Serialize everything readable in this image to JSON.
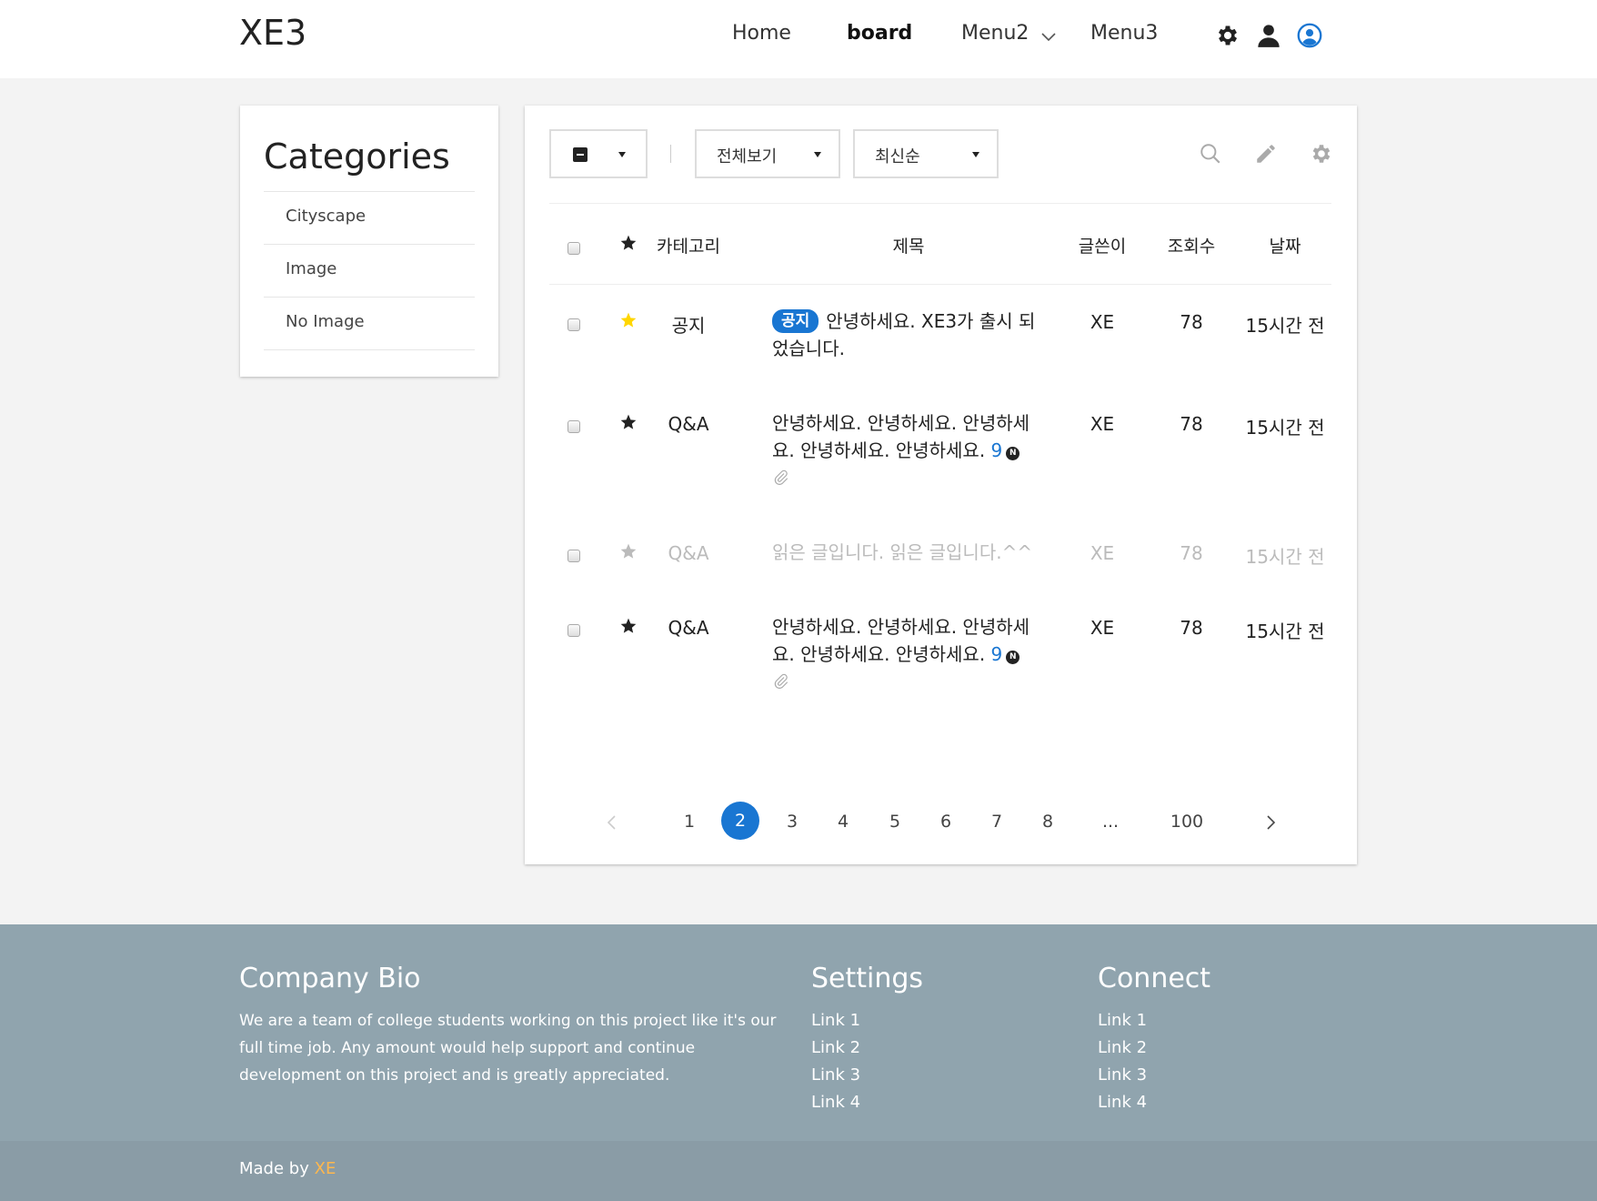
{
  "header": {
    "logo": "XE3",
    "nav": [
      {
        "label": "Home"
      },
      {
        "label": "board"
      },
      {
        "label": "Menu2"
      },
      {
        "label": "Menu3"
      }
    ],
    "icons": [
      "gear-icon",
      "user-icon",
      "account-circle-icon"
    ]
  },
  "sidebar": {
    "title": "Categories",
    "items": [
      {
        "label": "Cityscape"
      },
      {
        "label": "Image"
      },
      {
        "label": "No Image"
      }
    ]
  },
  "toolbar": {
    "view_select": "전체보기",
    "sort_select": "최신순",
    "icons": [
      "search-icon",
      "pencil-icon",
      "gear-icon"
    ]
  },
  "table": {
    "headers": {
      "category": "카테고리",
      "title": "제목",
      "author": "글쓴이",
      "views": "조회수",
      "date": "날짜"
    },
    "rows": [
      {
        "category": "공지",
        "badge": "공지",
        "title": "안녕하세요. XE3가 출시 되었습니다.",
        "author": "XE",
        "views": "78",
        "date": "15시간 전",
        "starred": true,
        "read": false
      },
      {
        "category": "Q&A",
        "title": "안녕하세요. 안녕하세요. 안녕하세요. 안녕하세요. 안녕하세요.",
        "comment_count": "9",
        "new_mark": "N",
        "attachment": true,
        "author": "XE",
        "views": "78",
        "date": "15시간 전",
        "starred": false,
        "read": false
      },
      {
        "category": "Q&A",
        "title": "읽은 글입니다. 읽은 글입니다.^^",
        "author": "XE",
        "views": "78",
        "date": "15시간 전",
        "starred": false,
        "read": true
      },
      {
        "category": "Q&A",
        "title": "안녕하세요. 안녕하세요. 안녕하세요. 안녕하세요. 안녕하세요.",
        "comment_count": "9",
        "new_mark": "N",
        "attachment": true,
        "author": "XE",
        "views": "78",
        "date": "15시간 전",
        "starred": false,
        "read": false
      }
    ]
  },
  "pagination": {
    "pages": [
      "1",
      "2",
      "3",
      "4",
      "5",
      "6",
      "7",
      "8",
      "...",
      "100"
    ],
    "current": "2"
  },
  "footer": {
    "bio": {
      "title": "Company Bio",
      "text": "We are a team of college students working on this project like it's our full time job. Any amount would help support and continue development on this project and is greatly appreciated."
    },
    "settings": {
      "title": "Settings",
      "links": [
        "Link 1",
        "Link 2",
        "Link 3",
        "Link 4"
      ]
    },
    "connect": {
      "title": "Connect",
      "links": [
        "Link 1",
        "Link 2",
        "Link 3",
        "Link 4"
      ]
    },
    "made_by_prefix": "Made by",
    "made_by_link": "XE"
  },
  "colors": {
    "accent": "#1976d2",
    "star_active": "#ffd600",
    "footer_bg": "#90a4ae",
    "subfooter_bg": "#8a9ca6",
    "made_by_link": "#ffb74d"
  }
}
